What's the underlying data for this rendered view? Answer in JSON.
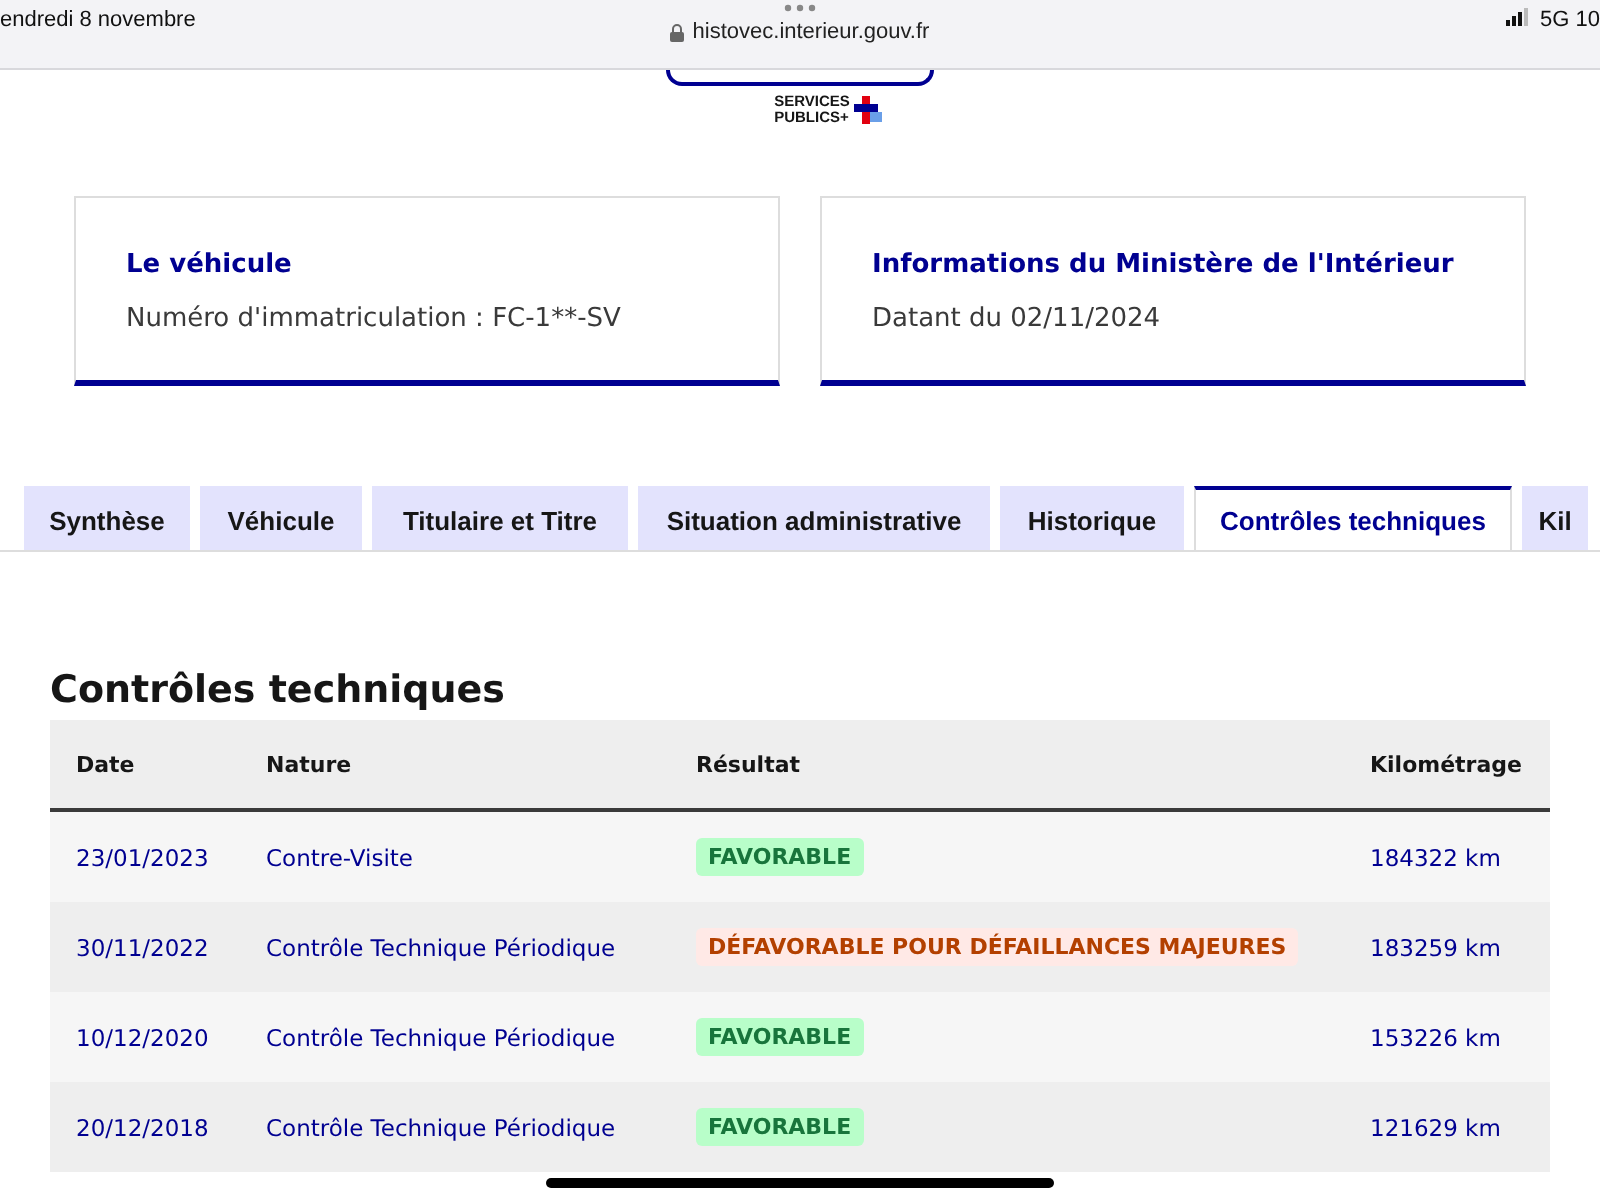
{
  "status_bar": {
    "date": "endredi 8 novembre",
    "url": "histovec.interieur.gouv.fr",
    "network": "5G 10"
  },
  "logo": {
    "line_1": "SERVICES",
    "line_2": "PUBLICS+"
  },
  "cards": [
    {
      "title": "Le véhicule",
      "text": "Numéro d'immatriculation : FC-1**-SV"
    },
    {
      "title": "Informations du Ministère de l'Intérieur",
      "text": "Datant du 02/11/2024"
    }
  ],
  "tabs": [
    {
      "label": "Synthèse",
      "selected": false
    },
    {
      "label": "Véhicule",
      "selected": false
    },
    {
      "label": "Titulaire et Titre",
      "selected": false
    },
    {
      "label": "Situation administrative",
      "selected": false
    },
    {
      "label": "Historique",
      "selected": false
    },
    {
      "label": "Contrôles techniques",
      "selected": true
    },
    {
      "label": "Kil",
      "selected": false
    }
  ],
  "section_title": "Contrôles techniques",
  "table": {
    "columns": [
      "Date",
      "Nature",
      "Résultat",
      "Kilométrage"
    ],
    "rows": [
      {
        "date": "23/01/2023",
        "nature": "Contre-Visite",
        "result": "FAVORABLE",
        "kind": "favorable",
        "mileage": "184322 km"
      },
      {
        "date": "30/11/2022",
        "nature": "Contrôle Technique Périodique",
        "result": "DÉFAVORABLE POUR DÉFAILLANCES MAJEURES",
        "kind": "unfavorable",
        "mileage": "183259 km"
      },
      {
        "date": "10/12/2020",
        "nature": "Contrôle Technique Périodique",
        "result": "FAVORABLE",
        "kind": "favorable",
        "mileage": "153226 km"
      },
      {
        "date": "20/12/2018",
        "nature": "Contrôle Technique Périodique",
        "result": "FAVORABLE",
        "kind": "favorable",
        "mileage": "121629 km"
      }
    ]
  }
}
